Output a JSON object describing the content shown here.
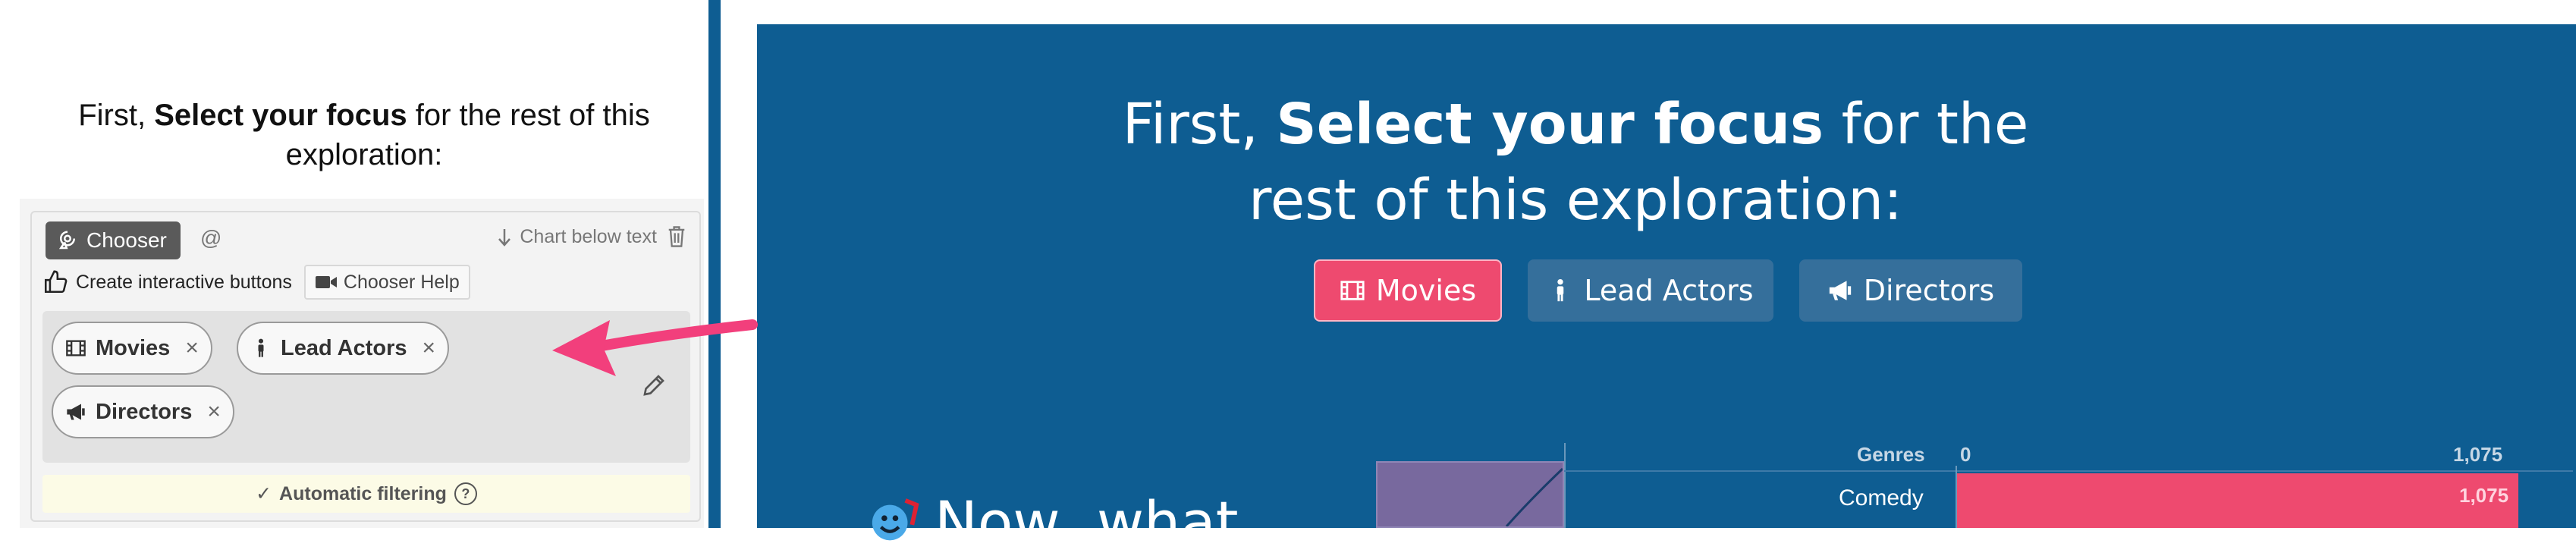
{
  "editor": {
    "title_prefix": "First, ",
    "title_bold": "Select your focus",
    "title_suffix": " for the rest of this exploration:",
    "chooser_label": "Chooser",
    "at_sign": "@",
    "chart_below_text": "Chart below text",
    "create_label": "Create interactive buttons",
    "help_label": "Chooser Help",
    "pills": [
      {
        "label": "Movies",
        "icon": "film-icon"
      },
      {
        "label": "Lead Actors",
        "icon": "person-icon"
      },
      {
        "label": "Directors",
        "icon": "megaphone-icon"
      }
    ],
    "pill_remove": "×",
    "auto_filtering": "Automatic filtering",
    "help_mark": "?"
  },
  "preview": {
    "title_prefix": "First, ",
    "title_bold": "Select your focus",
    "title_suffix": " for the rest of this exploration:",
    "buttons": [
      {
        "label": "Movies",
        "icon": "film-icon",
        "active": true
      },
      {
        "label": "Lead Actors",
        "icon": "person-icon",
        "active": false
      },
      {
        "label": "Directors",
        "icon": "megaphone-icon",
        "active": false
      }
    ],
    "next_heading": "Now, what"
  },
  "chart_data": {
    "type": "bar",
    "ylabel": "Genres",
    "ticks": [
      "0",
      "1,075"
    ],
    "categories": [
      "Comedy"
    ],
    "values": [
      1075
    ],
    "value_labels": [
      "1,075"
    ],
    "xlim": [
      0,
      1075
    ]
  },
  "colors": {
    "accent": "#ee4a6f",
    "preview_bg": "#0e5d92",
    "inactive_button": "#356f9b",
    "chooser_tag": "#5a5a5a"
  }
}
